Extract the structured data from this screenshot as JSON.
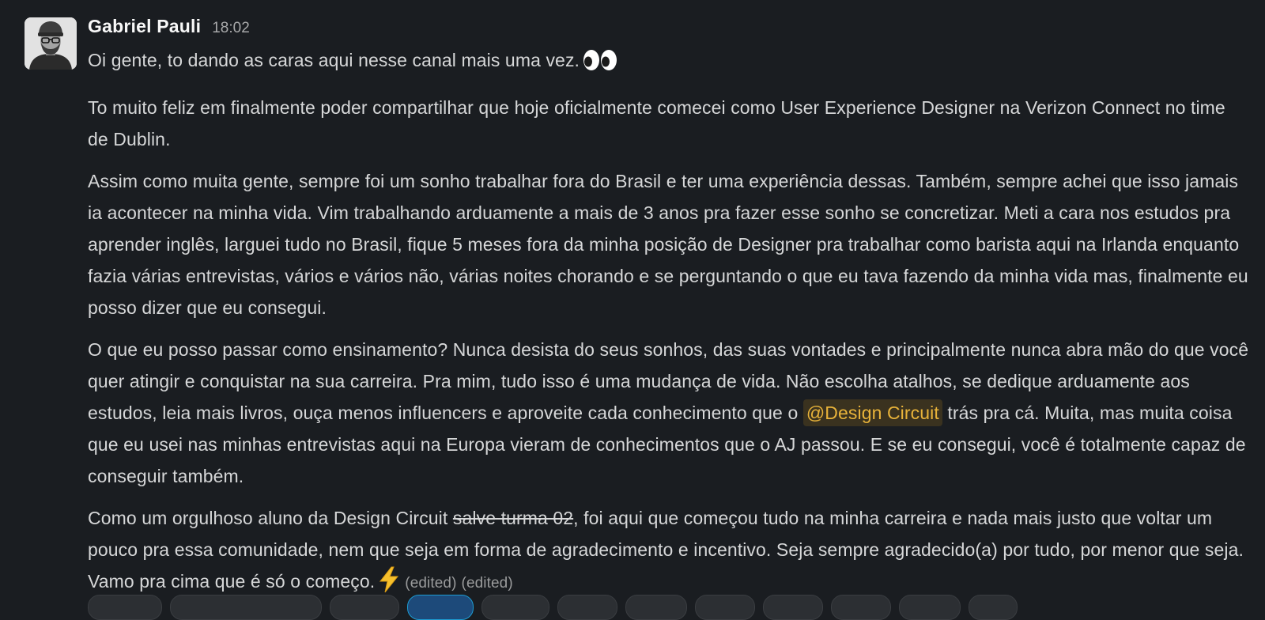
{
  "message": {
    "author": "Gabriel Pauli",
    "timestamp": "18:02",
    "avatar_icon": "person-with-glasses-and-beanie",
    "paragraphs": {
      "p1": "Oi gente, to dando as caras aqui nesse canal mais uma vez.",
      "p1_emoji": "eyes-emoji",
      "p2": "To muito feliz em finalmente poder compartilhar que hoje oficialmente comecei como User Experience Designer na Verizon Connect no time de Dublin.",
      "p3": "Assim como muita gente, sempre foi um sonho trabalhar fora do Brasil e ter uma experiência dessas. Também, sempre achei que isso jamais ia acontecer na minha vida. Vim trabalhando arduamente a mais de 3 anos pra fazer esse sonho se concretizar. Meti a cara nos estudos pra aprender inglês, larguei tudo no Brasil, fique 5 meses fora da minha posição de Designer pra trabalhar como barista aqui na Irlanda enquanto fazia várias entrevistas, vários e vários não, várias noites chorando e se perguntando o que eu tava fazendo da minha vida mas, finalmente eu posso dizer que eu consegui.",
      "p4_before": "O que eu posso passar como ensinamento? Nunca desista do seus sonhos, das suas vontades e principalmente nunca abra mão do que você quer atingir e conquistar na sua carreira. Pra mim, tudo isso é uma mudança de vida. Não escolha atalhos, se dedique arduamente aos estudos, leia mais livros, ouça menos influencers e aproveite cada conhecimento que o",
      "p4_mention": "@Design Circuit",
      "p4_after": "trás pra cá. Muita, mas muita coisa que eu usei nas minhas entrevistas aqui na Europa vieram de conhecimentos que o AJ passou. E se eu consegui, você é totalmente capaz de conseguir também.",
      "p5_before": "Como um orgulhoso aluno da Design Circuit",
      "p5_strike": "salve turma 02",
      "p5_after": ", foi aqui que começou tudo na minha carreira e nada mais justo que voltar um pouco pra essa comunidade, nem que seja em forma de agradecimento e incentivo. Seja sempre agradecido(a) por tudo, por menor que seja. Vamo pra cima que é só o começo.",
      "p5_emoji": "lightning-emoji",
      "edited_1": "(edited)",
      "edited_2": "(edited)"
    }
  },
  "colors": {
    "background": "#1a1d21",
    "mention_text": "#e8b33a",
    "mention_bg": "#3a321f"
  }
}
